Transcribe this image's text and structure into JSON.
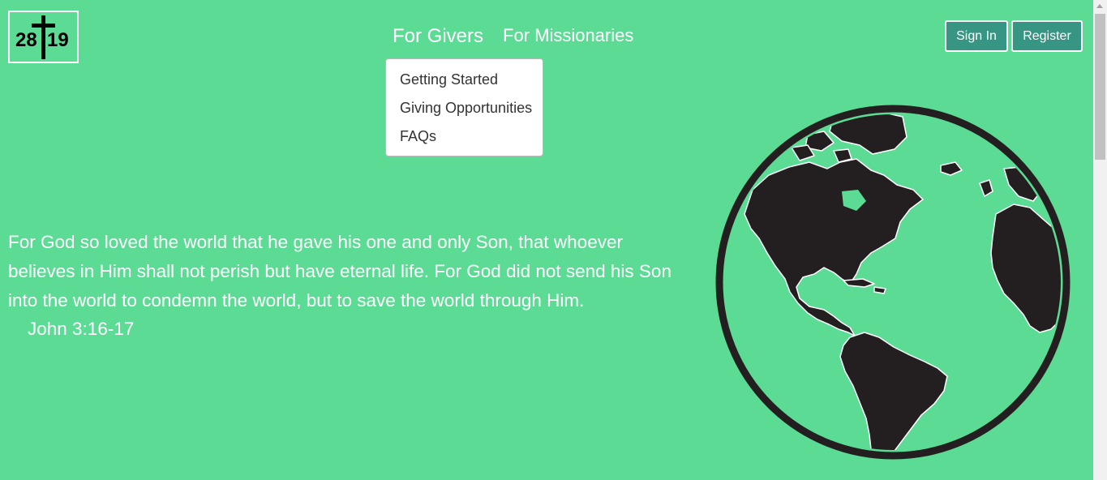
{
  "logo": {
    "left_number": "28",
    "right_number": "19"
  },
  "nav": {
    "givers_label": "For Givers",
    "missionaries_label": "For Missionaries"
  },
  "dropdown": {
    "items": [
      "Getting Started",
      "Giving Opportunities",
      "FAQs"
    ]
  },
  "auth": {
    "signin_label": "Sign In",
    "register_label": "Register"
  },
  "verse": {
    "text": "For God so loved the world that he gave his one and only Son, that whoever believes in Him shall not perish but have eternal life. For God did not send his Son into the world to condemn the world, but to save the world through Him.",
    "reference": "John 3:16-17"
  },
  "colors": {
    "background": "#5cdb95",
    "button": "#379683",
    "text": "#ffffff",
    "globe_land": "#231f20"
  },
  "icons": {
    "logo": "cross-logo-icon",
    "globe": "globe-icon"
  }
}
